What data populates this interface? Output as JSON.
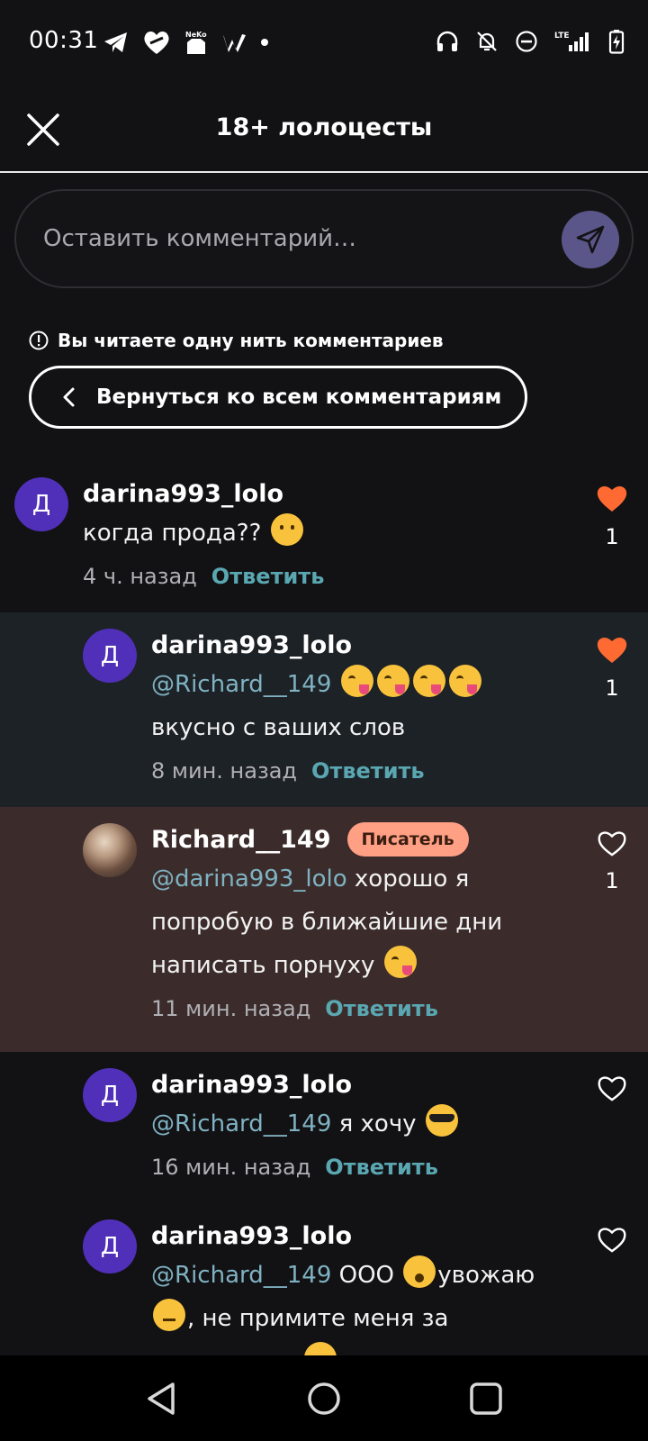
{
  "status_bar": {
    "time": "00:31",
    "notification_icons": [
      "telegram-icon",
      "heart-app-icon",
      "neko-icon",
      "wattpad-icon"
    ],
    "system_icons": [
      "headphones-icon",
      "bell-off-icon",
      "do-not-disturb-icon",
      "signal-icon",
      "battery-icon"
    ],
    "network": "LTE"
  },
  "header": {
    "title": "18+ лолоцесты"
  },
  "comment_input": {
    "placeholder": "Оставить комментарий…"
  },
  "thread": {
    "notice": "Вы читаете одну нить комментариев",
    "back_label": "Вернуться ко всем комментариям"
  },
  "comments": [
    {
      "avatar_letter": "Д",
      "username": "darina993_lolo",
      "text": "когда прода??",
      "time": "4 ч. назад",
      "reply": "Ответить",
      "liked": true,
      "like_count": "1"
    },
    {
      "avatar_letter": "Д",
      "username": "darina993_lolo",
      "mention": "@Richard__149",
      "text": "вкусно с ваших слов",
      "time": "8 мин. назад",
      "reply": "Ответить",
      "liked": true,
      "like_count": "1"
    },
    {
      "username": "Richard__149",
      "badge": "Писатель",
      "mention": "@darina993_lolo",
      "text_line1": "хорошо я",
      "text_line2": "попробую в ближайшие дни",
      "text_line3": "написать порнуху",
      "time": "11 мин. назад",
      "reply": "Ответить",
      "liked": false,
      "like_count": "1"
    },
    {
      "avatar_letter": "Д",
      "username": "darina993_lolo",
      "mention": "@Richard__149",
      "text": "я хочу",
      "time": "16 мин. назад",
      "reply": "Ответить",
      "liked": false
    },
    {
      "avatar_letter": "Д",
      "username": "darina993_lolo",
      "mention": "@Richard__149",
      "text_line1": "ООО",
      "text_line1b": "увожаю",
      "text_line2": ", не примите меня за",
      "liked": false
    }
  ],
  "colors": {
    "background": "#121214",
    "highlight_reply": "#1d2227",
    "highlight_author": "#3b2c2b",
    "accent_heart": "#ff6a32",
    "mention": "#7fb2c2",
    "reply_link": "#5aa7b2",
    "badge": "#ff9f83",
    "avatar": "#5030b8"
  },
  "nav_bar": {
    "buttons": [
      "back-icon",
      "home-icon",
      "recents-icon"
    ]
  }
}
